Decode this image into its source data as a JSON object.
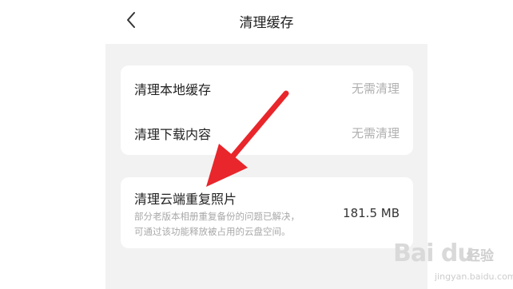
{
  "header": {
    "title": "清理缓存",
    "back_icon": "chevron-left-icon"
  },
  "cache_card": {
    "items": [
      {
        "label": "清理本地缓存",
        "status": "无需清理"
      },
      {
        "label": "清理下载内容",
        "status": "无需清理"
      }
    ]
  },
  "duplicate_card": {
    "title": "清理云端重复照片",
    "description_line1": "部分老版本相册重复备份的问题已解决，",
    "description_line2": "可通过该功能释放被占用的云盘空间。",
    "size": "181.5 MB"
  },
  "annotation": {
    "arrow_color": "#e8262b"
  },
  "watermark": {
    "logo_text": "Bai du",
    "jingyan": "经验",
    "url": "jingyan.baidu.com"
  }
}
